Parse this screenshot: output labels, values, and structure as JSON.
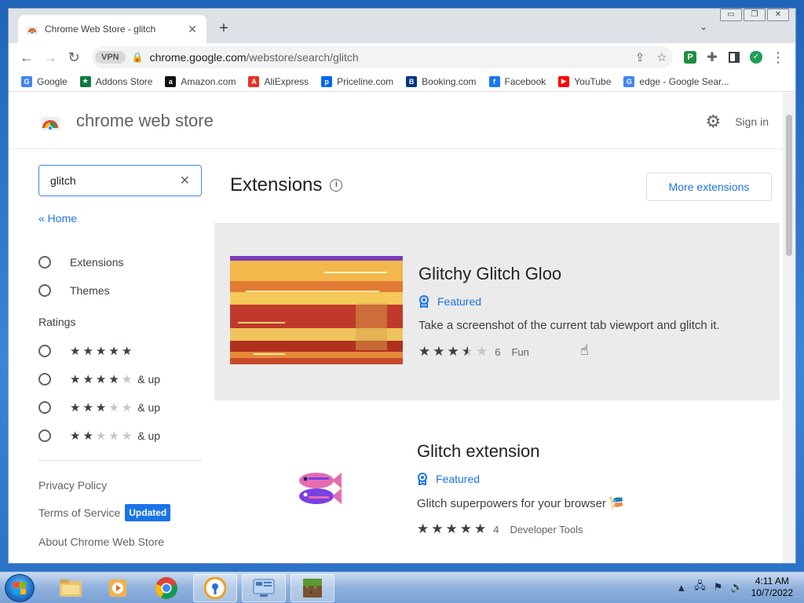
{
  "browser": {
    "tab_title": "Chrome Web Store - glitch",
    "tab_close": "✕",
    "new_tab": "+",
    "tab_search": "⌄",
    "window_controls": [
      "▭",
      "❐",
      "✕"
    ],
    "vpn_label": "VPN",
    "url_domain": "chrome.google.com",
    "url_path": "/webstore/search/glitch",
    "ext_p_label": "P"
  },
  "bookmarks": [
    {
      "label": "Google",
      "icon": "G",
      "color": "#4285f4"
    },
    {
      "label": "Addons Store",
      "icon": "★",
      "color": "#0f7a3e"
    },
    {
      "label": "Amazon.com",
      "icon": "a",
      "color": "#111111"
    },
    {
      "label": "AliExpress",
      "icon": "A",
      "color": "#e43225"
    },
    {
      "label": "Priceline.com",
      "icon": "p",
      "color": "#0068ef"
    },
    {
      "label": "Booking.com",
      "icon": "B",
      "color": "#003580"
    },
    {
      "label": "Facebook",
      "icon": "f",
      "color": "#1877f2"
    },
    {
      "label": "YouTube",
      "icon": "▶",
      "color": "#ff0000"
    },
    {
      "label": "edge - Google Sear...",
      "icon": "G",
      "color": "#4285f4"
    }
  ],
  "store": {
    "title": "chrome web store",
    "sign_in": "Sign in"
  },
  "sidebar": {
    "search_value": "glitch",
    "clear": "✕",
    "home_link": "« Home",
    "types": [
      "Extensions",
      "Themes"
    ],
    "ratings_title": "Ratings",
    "ratings": [
      {
        "stars": 5,
        "suffix": ""
      },
      {
        "stars": 4,
        "suffix": "& up"
      },
      {
        "stars": 3,
        "suffix": "& up"
      },
      {
        "stars": 2,
        "suffix": "& up"
      }
    ],
    "links": {
      "privacy": "Privacy Policy",
      "terms": "Terms of Service",
      "updated_badge": "Updated",
      "about": "About Chrome Web Store"
    }
  },
  "main": {
    "section_title": "Extensions",
    "info_icon": "i",
    "more_button": "More extensions",
    "results": [
      {
        "title": "Glitchy Glitch Gloo",
        "featured": "Featured",
        "description": "Take a screenshot of the current tab viewport and glitch it.",
        "rating": 3.5,
        "rating_count": "6",
        "category": "Fun"
      },
      {
        "title": "Glitch extension",
        "featured": "Featured",
        "description": "Glitch superpowers for your browser 🎏",
        "rating": 5,
        "rating_count": "4",
        "category": "Developer Tools"
      }
    ]
  },
  "taskbar": {
    "time": "4:11 AM",
    "date": "10/7/2022"
  },
  "colors": {
    "accent": "#1a73e8",
    "hover_card": "#ebebeb"
  }
}
